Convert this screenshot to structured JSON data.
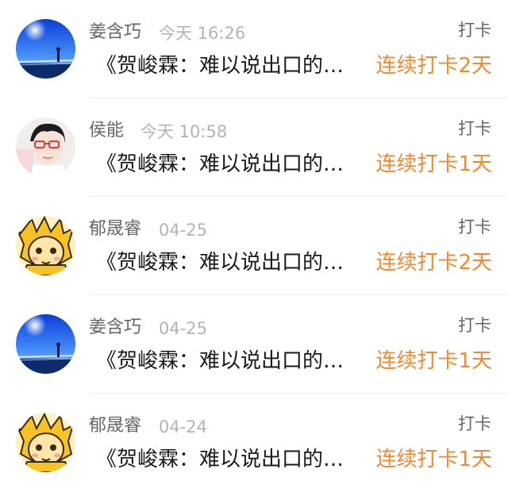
{
  "accent_color": "#f08a30",
  "items": [
    {
      "avatar": "sky-bridge-avatar",
      "name": "姜含巧",
      "time": "今天 16:26",
      "type": "打卡",
      "content": "《贺峻霖：难以说出口的…",
      "streak": "连续打卡2天"
    },
    {
      "avatar": "boy-glasses-avatar",
      "name": "侯能",
      "time": "今天 10:58",
      "type": "打卡",
      "content": "《贺峻霖：难以说出口的…",
      "streak": "连续打卡1天"
    },
    {
      "avatar": "yellow-cartoon-avatar",
      "name": "郁晟睿",
      "time": "04-25",
      "type": "打卡",
      "content": "《贺峻霖：难以说出口的…",
      "streak": "连续打卡2天"
    },
    {
      "avatar": "sky-bridge-avatar",
      "name": "姜含巧",
      "time": "04-25",
      "type": "打卡",
      "content": "《贺峻霖：难以说出口的…",
      "streak": "连续打卡1天"
    },
    {
      "avatar": "yellow-cartoon-avatar",
      "name": "郁晟睿",
      "time": "04-24",
      "type": "打卡",
      "content": "《贺峻霖：难以说出口的…",
      "streak": "连续打卡1天"
    }
  ]
}
